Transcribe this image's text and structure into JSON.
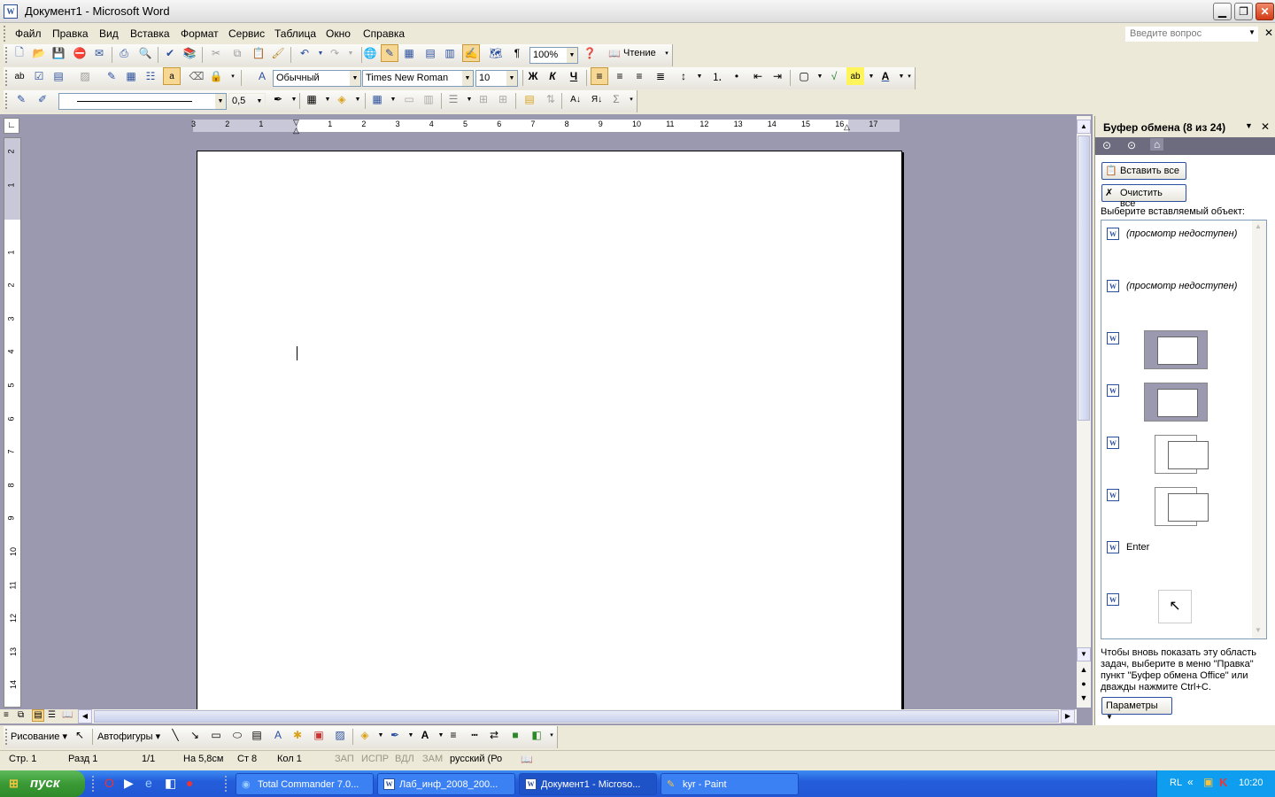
{
  "window": {
    "title": "Документ1 - Microsoft Word"
  },
  "menu": {
    "items": [
      "Файл",
      "Правка",
      "Вид",
      "Вставка",
      "Формат",
      "Сервис",
      "Таблица",
      "Окно",
      "Справка"
    ],
    "ask_placeholder": "Введите вопрос"
  },
  "toolbar_standard": {
    "zoom": "100%",
    "reading_label": "Чтение"
  },
  "toolbar_format": {
    "style": "Обычный",
    "font": "Times New Roman",
    "size": "10",
    "bold": "Ж",
    "italic": "К",
    "underline": "Ч"
  },
  "toolbar_tables": {
    "line_weight": "0,5",
    "sum": "Σ"
  },
  "ruler": {
    "top_labels": [
      "3",
      "2",
      "1",
      "1",
      "2",
      "3",
      "4",
      "5",
      "6",
      "7",
      "8",
      "9",
      "10",
      "11",
      "12",
      "13",
      "14",
      "15",
      "16",
      "17"
    ],
    "side_labels": [
      "2",
      "1",
      "1",
      "2",
      "3",
      "4",
      "5",
      "6",
      "7",
      "8",
      "9",
      "10",
      "11",
      "12",
      "13",
      "14"
    ]
  },
  "taskpane": {
    "title": "Буфер обмена (8 из 24)",
    "paste_all": "Вставить все",
    "clear_all": "Очистить все",
    "select_label": "Выберите вставляемый объект:",
    "items": [
      {
        "text": "(просмотр недоступен)",
        "kind": "text"
      },
      {
        "text": "(просмотр недоступен)",
        "kind": "text"
      },
      {
        "text": "",
        "kind": "thumb"
      },
      {
        "text": "",
        "kind": "thumb"
      },
      {
        "text": "",
        "kind": "thumb"
      },
      {
        "text": "",
        "kind": "thumb"
      },
      {
        "text": "Enter",
        "kind": "plain"
      },
      {
        "text": "",
        "kind": "cursor"
      }
    ],
    "hint": "Чтобы вновь показать эту область задач, выберите в меню \"Правка\" пункт \"Буфер обмена Office\" или дважды нажмите Ctrl+C.",
    "params": "Параметры"
  },
  "drawing": {
    "draw_label": "Рисование",
    "autoshapes_label": "Автофигуры"
  },
  "status": {
    "page": "Стр. 1",
    "section": "Разд 1",
    "pages": "1/1",
    "at": "На 5,8см",
    "line": "Ст 8",
    "col": "Кол 1",
    "rec": "ЗАП",
    "trk": "ИСПР",
    "ext": "ВДЛ",
    "ovr": "ЗАМ",
    "lang": "русский (Ро"
  },
  "taskbar": {
    "start": "пуск",
    "tasks": [
      "Total Commander 7.0...",
      "Лаб_инф_2008_200...",
      "Документ1 - Microso...",
      "kyr - Paint"
    ],
    "lang": "RL",
    "time": "10:20"
  },
  "colors": {
    "accent": "#2a4f9e",
    "workspace": "#9a99b0",
    "taskbar": "#245edb",
    "start": "#3a9a35"
  }
}
